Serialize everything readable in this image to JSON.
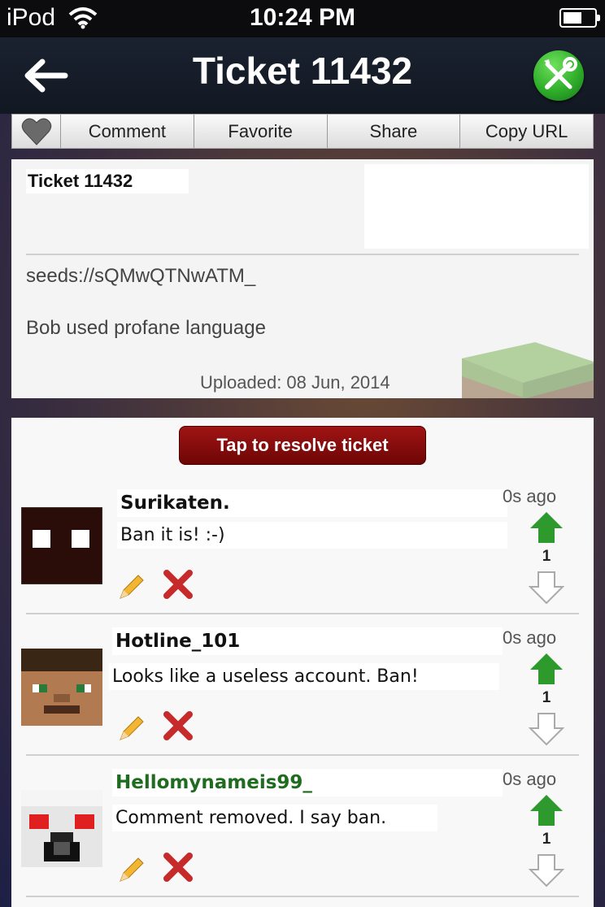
{
  "status_bar": {
    "carrier": "iPod",
    "time": "10:24 PM",
    "icons": [
      "wifi-icon",
      "battery-icon"
    ]
  },
  "nav": {
    "title": "Ticket 11432",
    "back_icon": "back-arrow-icon",
    "tools_icon": "wrench-screwdriver-icon"
  },
  "toolbar": {
    "heart_icon": "heart-icon",
    "buttons": [
      "Comment",
      "Favorite",
      "Share",
      "Copy URL"
    ]
  },
  "ticket": {
    "title": "Ticket 11432",
    "seed": "seeds://sQMwQTNwATM_",
    "description": "Bob used profane language",
    "uploaded": "Uploaded: 08 Jun, 2014"
  },
  "resolve_label": "Tap to resolve ticket",
  "comments": [
    {
      "author": "Surikaten.",
      "text": "Ban it is! :-)",
      "time": "0s ago",
      "votes": "1"
    },
    {
      "author": "Hotline_101",
      "text": "Looks like a useless account. Ban!",
      "time": "0s ago",
      "votes": "1"
    },
    {
      "author": "Hellomynameis99_",
      "text": "Comment removed. I say ban.",
      "time": "0s ago",
      "votes": "1"
    }
  ],
  "colors": {
    "nav_bg": "#121822",
    "resolve_bg": "#8b0c0c",
    "upvote": "#2e9a2e",
    "third_author": "#1f6b1f",
    "delete": "#c62a2a"
  }
}
